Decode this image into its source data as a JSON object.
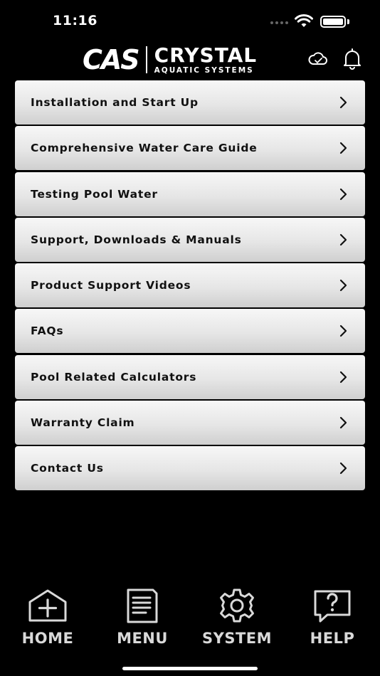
{
  "status_bar": {
    "time": "11:16"
  },
  "header": {
    "logo_mark": "CAS",
    "logo_line1": "CRYSTAL",
    "logo_line2": "AQUATIC SYSTEMS",
    "cloud_icon": "cloud-sync-icon",
    "bell_icon": "bell-icon"
  },
  "menu": {
    "items": [
      {
        "label": "Installation and Start Up"
      },
      {
        "label": "Comprehensive Water Care Guide"
      },
      {
        "label": "Testing Pool Water"
      },
      {
        "label": "Support, Downloads & Manuals"
      },
      {
        "label": "Product Support Videos"
      },
      {
        "label": "FAQs"
      },
      {
        "label": "Pool Related Calculators"
      },
      {
        "label": "Warranty Claim"
      },
      {
        "label": "Contact Us"
      }
    ]
  },
  "bottom_nav": {
    "home": "HOME",
    "menu": "MENU",
    "system": "SYSTEM",
    "help": "HELP"
  }
}
